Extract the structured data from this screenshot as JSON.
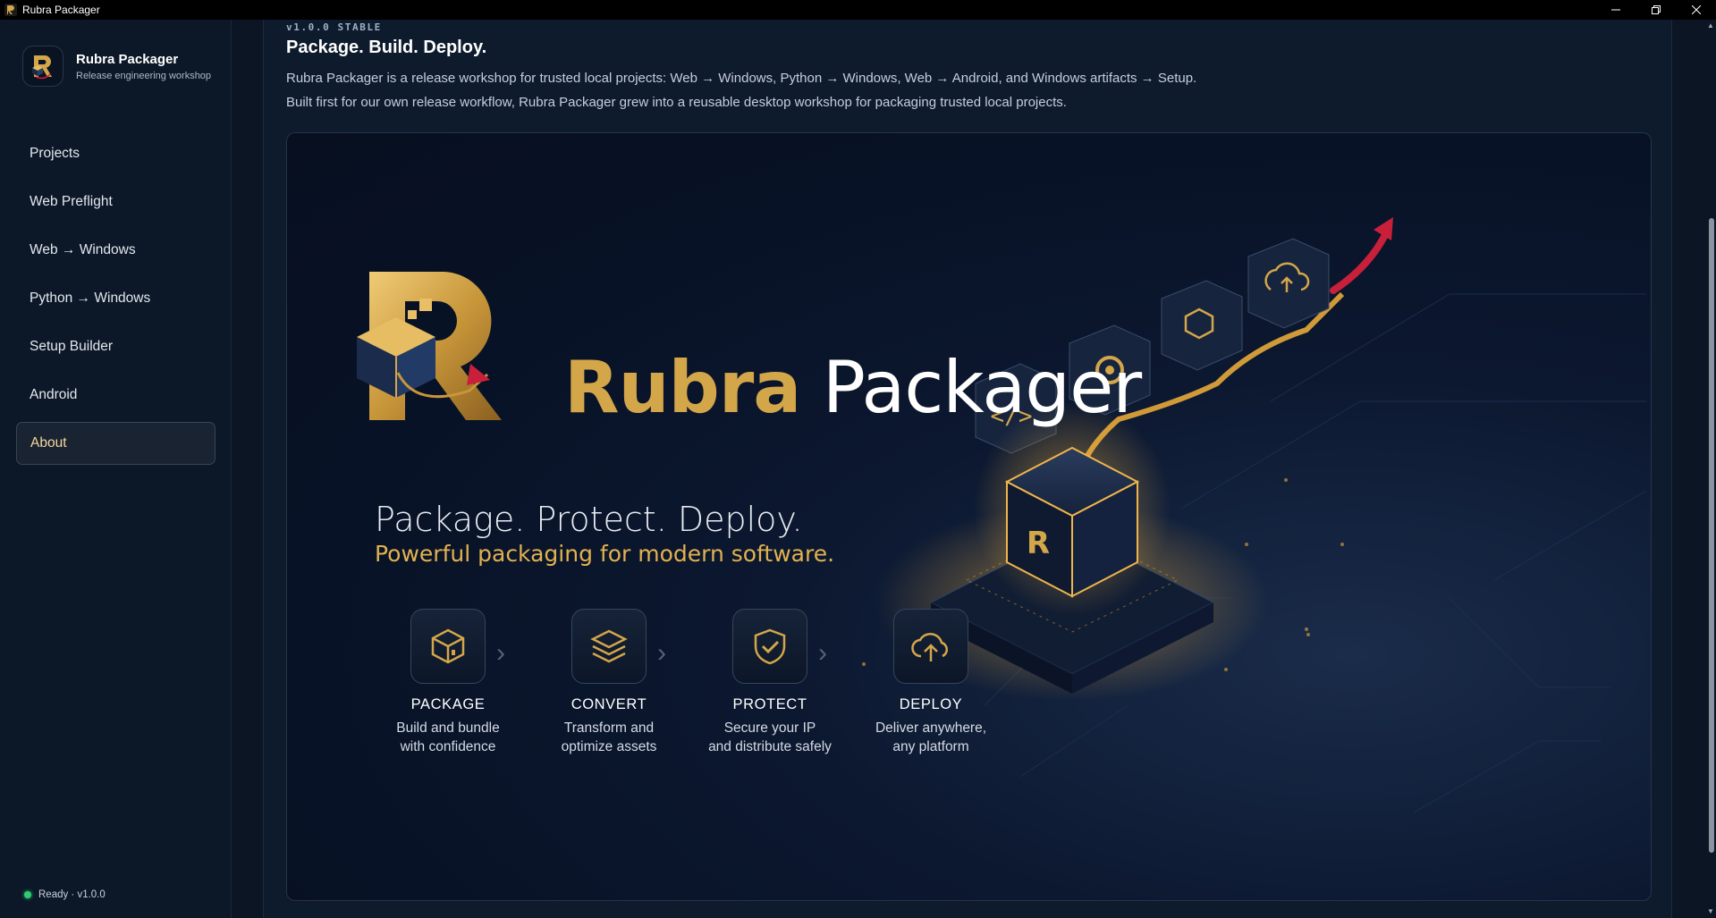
{
  "window": {
    "title": "Rubra Packager",
    "controls": [
      "minimize",
      "restore",
      "close"
    ]
  },
  "sidebar": {
    "brand_name": "Rubra Packager",
    "brand_sub": "Release engineering workshop",
    "items": [
      {
        "label": "Projects"
      },
      {
        "label": "Web Preflight"
      },
      {
        "label": "Web → Windows"
      },
      {
        "label": "Python → Windows"
      },
      {
        "label": "Setup Builder"
      },
      {
        "label": "Android"
      },
      {
        "label": "About",
        "active": true
      }
    ],
    "status": "Ready · v1.0.0",
    "status_color": "#2ecc71"
  },
  "about": {
    "version": "v1.0.0 STABLE",
    "heading": "Package. Build. Deploy.",
    "desc1": "Rubra Packager is a release workshop for trusted local projects: Web → Windows, Python → Windows, Web → Android, and Windows artifacts → Setup.",
    "desc2": "Built first for our own release workflow, Rubra Packager grew into a reusable desktop workshop for packaging trusted local projects."
  },
  "hero": {
    "title_gold": "Rubra",
    "title_white": "Packager",
    "tagline": "Package. Protect. Deploy.",
    "subtitle": "Powerful packaging for modern software.",
    "steps": [
      {
        "icon": "package-icon",
        "name": "PACKAGE",
        "desc": "Build and bundle\nwith confidence"
      },
      {
        "icon": "layers-icon",
        "name": "CONVERT",
        "desc": "Transform and\noptimize assets"
      },
      {
        "icon": "shield-check-icon",
        "name": "PROTECT",
        "desc": "Secure your IP\nand distribute safely"
      },
      {
        "icon": "cloud-upload-icon",
        "name": "DEPLOY",
        "desc": "Deliver anywhere,\nany platform"
      }
    ],
    "float_icons": [
      "code-icon",
      "gear-icon",
      "box-icon",
      "cloud-upload-icon"
    ]
  },
  "colors": {
    "gold": "#d4a64a",
    "accent_red": "#c8203a",
    "background": "#0b1523"
  }
}
